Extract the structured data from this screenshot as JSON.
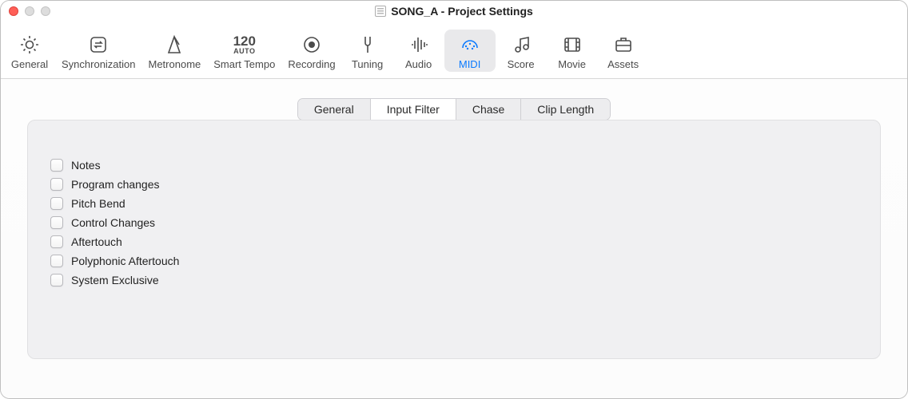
{
  "window": {
    "title": "SONG_A - Project Settings"
  },
  "toolbar": {
    "items": [
      {
        "label": "General"
      },
      {
        "label": "Synchronization"
      },
      {
        "label": "Metronome"
      },
      {
        "label": "Smart Tempo",
        "top": "120",
        "bot": "AUTO"
      },
      {
        "label": "Recording"
      },
      {
        "label": "Tuning"
      },
      {
        "label": "Audio"
      },
      {
        "label": "MIDI"
      },
      {
        "label": "Score"
      },
      {
        "label": "Movie"
      },
      {
        "label": "Assets"
      }
    ],
    "active_index": 7
  },
  "subtabs": {
    "items": [
      {
        "label": "General"
      },
      {
        "label": "Input Filter"
      },
      {
        "label": "Chase"
      },
      {
        "label": "Clip Length"
      }
    ],
    "active_index": 1
  },
  "checklist": [
    {
      "label": "Notes",
      "checked": false
    },
    {
      "label": "Program changes",
      "checked": false
    },
    {
      "label": "Pitch Bend",
      "checked": false
    },
    {
      "label": "Control Changes",
      "checked": false
    },
    {
      "label": "Aftertouch",
      "checked": false
    },
    {
      "label": "Polyphonic Aftertouch",
      "checked": false
    },
    {
      "label": "System Exclusive",
      "checked": false
    }
  ]
}
